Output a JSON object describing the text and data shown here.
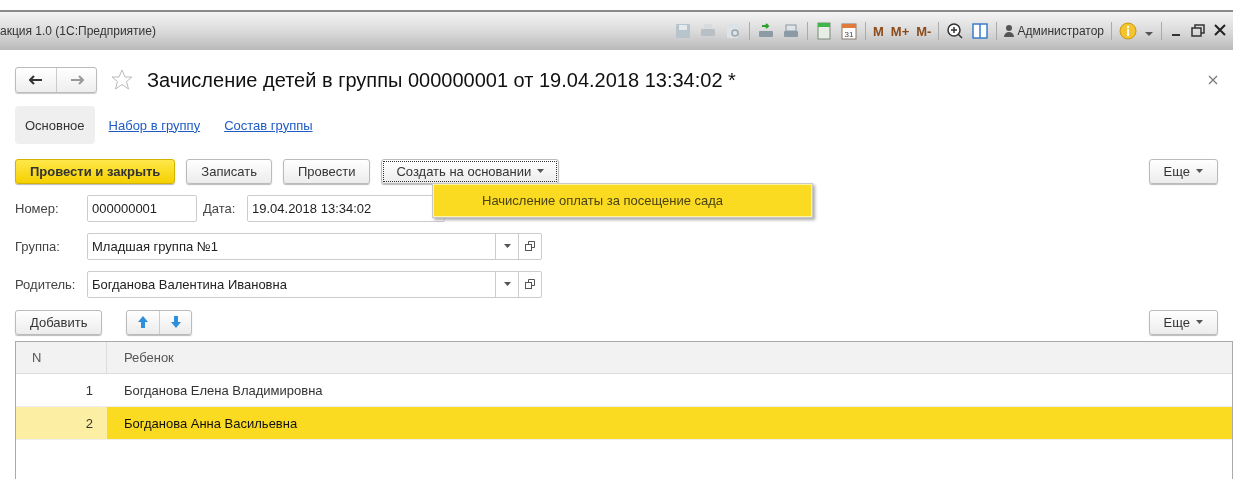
{
  "app_bar": {
    "title": "акция 1.0  (1С:Предприятие)",
    "calendar_day": "31",
    "memory_buttons": [
      "M",
      "M+",
      "M-"
    ],
    "user": "Администратор"
  },
  "form": {
    "title": "Зачисление детей в группы 000000001 от 19.04.2018 13:34:02 *",
    "favorite": false
  },
  "tabs": [
    {
      "label": "Основное",
      "selected": true
    },
    {
      "label": "Набор в группу",
      "selected": false
    },
    {
      "label": "Состав группы",
      "selected": false
    }
  ],
  "command_bar": {
    "buttons": [
      {
        "label": "Провести и закрыть",
        "kind": "primary"
      },
      {
        "label": "Записать",
        "kind": "normal"
      },
      {
        "label": "Провести",
        "kind": "normal"
      },
      {
        "label": "Создать на основании",
        "kind": "menu",
        "expanded": true
      }
    ],
    "more": "Еще"
  },
  "dropdown": {
    "items": [
      {
        "label": "Начисление оплаты за посещение сада",
        "selected": true
      }
    ]
  },
  "fields": {
    "number": {
      "label": "Номер:",
      "value": "000000001"
    },
    "date": {
      "label": "Дата:",
      "value": "19.04.2018 13:34:02"
    },
    "group": {
      "label": "Группа:",
      "value": "Младшая группа №1"
    },
    "parent": {
      "label": "Родитель:",
      "value": "Богданова Валентина Ивановна"
    }
  },
  "table_toolbar": {
    "add": "Добавить",
    "more": "Еще"
  },
  "table": {
    "columns": [
      "N",
      "Ребенок"
    ],
    "rows": [
      {
        "n": "1",
        "name": "Богданова Елена Владимировна",
        "selected": false
      },
      {
        "n": "2",
        "name": "Богданова Анна Васильевна",
        "selected": true
      }
    ]
  }
}
